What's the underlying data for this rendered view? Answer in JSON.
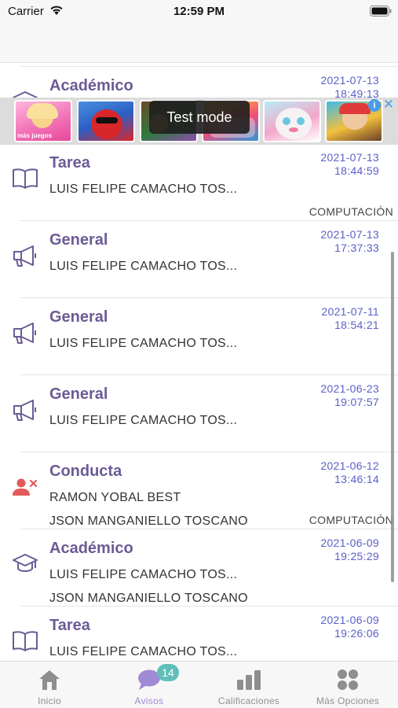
{
  "status_bar": {
    "carrier": "Carrier",
    "time": "12:59 PM"
  },
  "colors": {
    "accent_purple": "#6b5b95",
    "date_blue": "#5a5fc8",
    "conduct_red": "#e35a5a",
    "badge_teal": "#5fbfb8",
    "tab_active": "#a08ad6",
    "tab_inactive": "#8e8e8e"
  },
  "ad_banner": {
    "overlay_text": "Test mode",
    "tile_caption": "más juegos",
    "info_label": "i",
    "close_label": "✕"
  },
  "announcements": [
    {
      "category": "Académico",
      "icon": "graduation-cap-icon",
      "date": "2021-07-13",
      "time": "18:49:13",
      "line1": "",
      "line2": "",
      "subject": ""
    },
    {
      "category": "Tarea",
      "icon": "book-icon",
      "date": "2021-07-13",
      "time": "18:44:59",
      "line1": "LUIS FELIPE CAMACHO TOS...",
      "line2": "",
      "subject": "COMPUTACIÓN"
    },
    {
      "category": "General",
      "icon": "megaphone-icon",
      "date": "2021-07-13",
      "time": "17:37:33",
      "line1": "LUIS FELIPE CAMACHO TOS...",
      "line2": "",
      "subject": ""
    },
    {
      "category": "General",
      "icon": "megaphone-icon",
      "date": "2021-07-11",
      "time": "18:54:21",
      "line1": "LUIS FELIPE CAMACHO TOS...",
      "line2": "",
      "subject": ""
    },
    {
      "category": "General",
      "icon": "megaphone-icon",
      "date": "2021-06-23",
      "time": "19:07:57",
      "line1": "LUIS FELIPE CAMACHO TOS...",
      "line2": "",
      "subject": ""
    },
    {
      "category": "Conducta",
      "icon": "user-remove-icon",
      "date": "2021-06-12",
      "time": "13:46:14",
      "line1": "RAMON YOBAL BEST",
      "line2": "JSON MANGANIELLO TOSCANO",
      "subject": "COMPUTACIÓN"
    },
    {
      "category": "Académico",
      "icon": "graduation-cap-icon",
      "date": "2021-06-09",
      "time": "19:25:29",
      "line1": "LUIS FELIPE CAMACHO TOS...",
      "line2": "JSON MANGANIELLO TOSCANO",
      "subject": ""
    },
    {
      "category": "Tarea",
      "icon": "book-icon",
      "date": "2021-06-09",
      "time": "19:26:06",
      "line1": "LUIS FELIPE CAMACHO TOS...",
      "line2": "",
      "subject": ""
    }
  ],
  "tab_bar": {
    "tabs": [
      {
        "label": "Inicio",
        "icon": "home-icon",
        "active": false
      },
      {
        "label": "Avisos",
        "icon": "chat-bubble-icon",
        "active": true,
        "badge": "14"
      },
      {
        "label": "Calificaciones",
        "icon": "bar-chart-icon",
        "active": false
      },
      {
        "label": "Más Opciones",
        "icon": "grid-dots-icon",
        "active": false
      }
    ]
  }
}
